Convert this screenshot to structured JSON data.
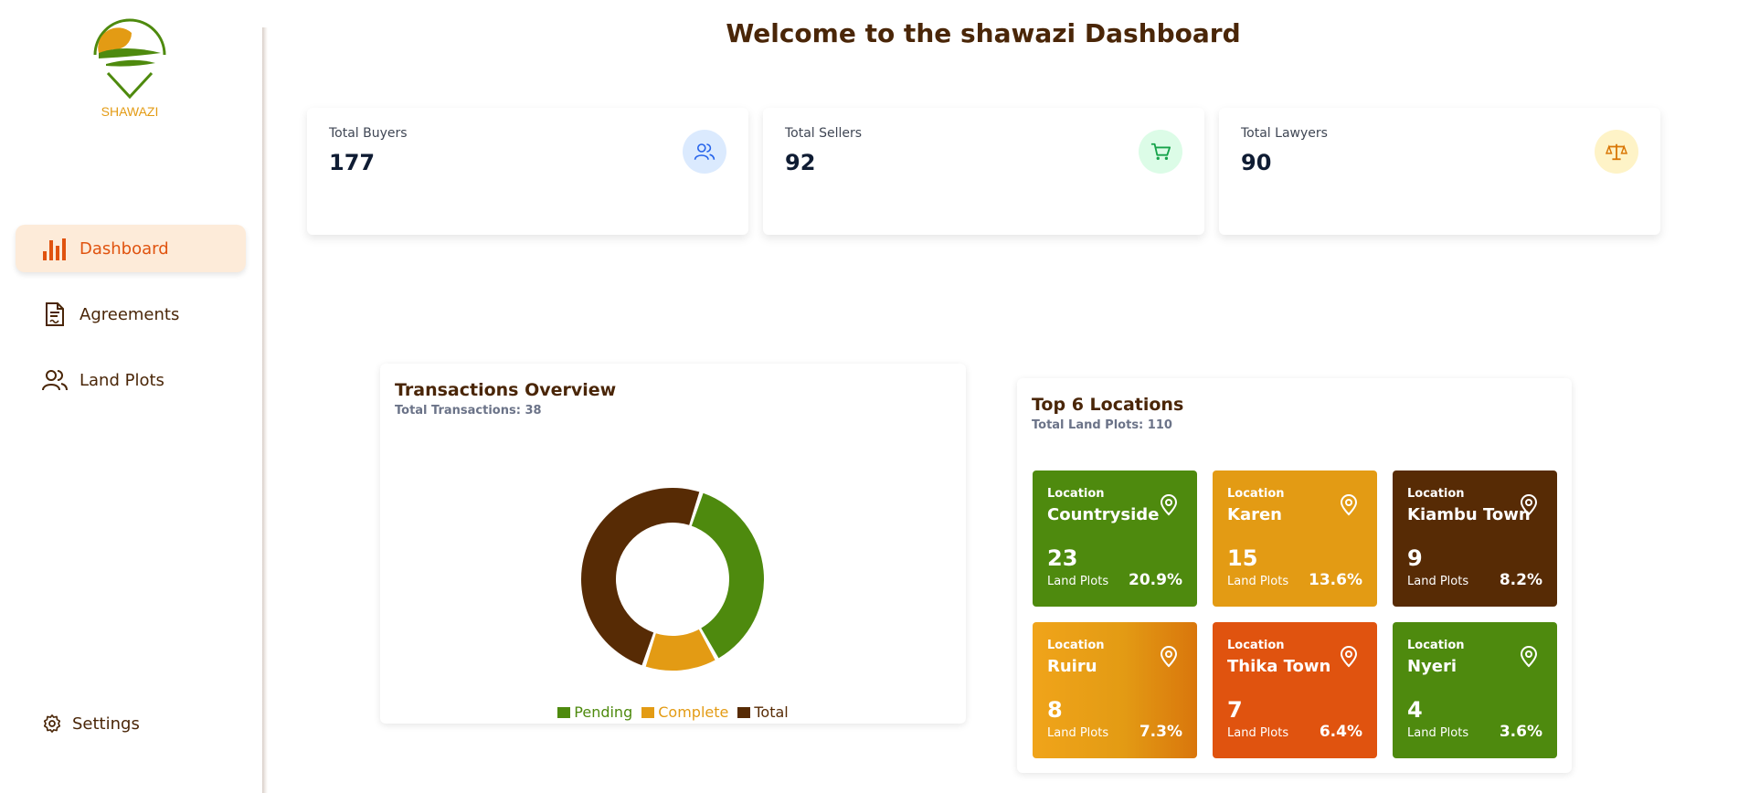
{
  "brand": {
    "logo_text": "SHAWAZI"
  },
  "sidebar": {
    "items": [
      {
        "label": "Dashboard",
        "icon": "bar-chart-icon",
        "active": true
      },
      {
        "label": "Agreements",
        "icon": "document-icon",
        "active": false
      },
      {
        "label": "Land Plots",
        "icon": "users-icon",
        "active": false
      }
    ],
    "settings_label": "Settings"
  },
  "header": {
    "title": "Welcome to the shawazi Dashboard"
  },
  "stats": [
    {
      "label": "Total Buyers",
      "value": "177",
      "icon": "users-icon",
      "icon_bg": "#dbeafe",
      "icon_color": "#2563eb"
    },
    {
      "label": "Total Sellers",
      "value": "92",
      "icon": "cart-icon",
      "icon_bg": "#dcfce7",
      "icon_color": "#16a34a"
    },
    {
      "label": "Total Lawyers",
      "value": "90",
      "icon": "scale-icon",
      "icon_bg": "#fef3c7",
      "icon_color": "#d97706"
    }
  ],
  "transactions": {
    "title": "Transactions Overview",
    "subtitle": "Total Transactions: 38"
  },
  "chart_data": {
    "type": "pie",
    "donut": true,
    "title": "",
    "categories": [
      "Pending",
      "Complete",
      "Total"
    ],
    "values": [
      14,
      5,
      19
    ],
    "colors": [
      "#4e8a0e",
      "#e39b14",
      "#572b05"
    ],
    "legend_position": "bottom"
  },
  "locations": {
    "title": "Top 6 Locations",
    "subtitle": "Total Land Plots: 110",
    "label": "Location",
    "unit": "Land Plots",
    "items": [
      {
        "name": "Countryside",
        "count": "23",
        "pct": "20.9%",
        "color": "#4e8a0e"
      },
      {
        "name": "Karen",
        "count": "15",
        "pct": "13.6%",
        "color": "#e39b14"
      },
      {
        "name": "Kiambu Town",
        "count": "9",
        "pct": "8.2%",
        "color": "#572b05"
      },
      {
        "name": "Ruiru",
        "count": "8",
        "pct": "7.3%",
        "color": "#e88f10"
      },
      {
        "name": "Thika Town",
        "count": "7",
        "pct": "6.4%",
        "color": "#e0530f"
      },
      {
        "name": "Nyeri",
        "count": "4",
        "pct": "3.6%",
        "color": "#4e8a0e"
      }
    ]
  }
}
